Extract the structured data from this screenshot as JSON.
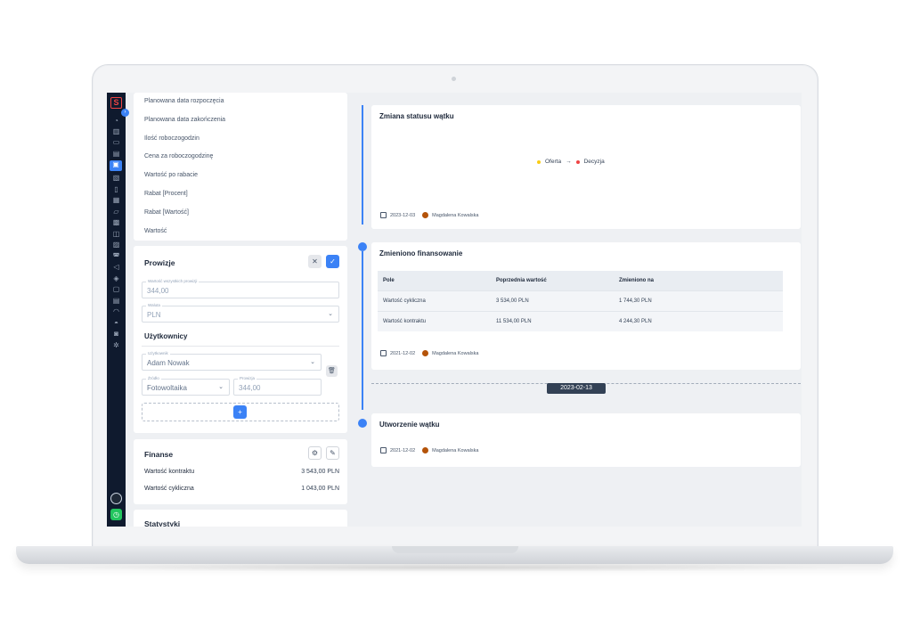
{
  "left": {
    "fields": [
      "Planowana data rozpoczęcia",
      "Planowana data zakończenia",
      "Ilość roboczogodzin",
      "Cena za roboczogodzinę",
      "Wartość po rabacie",
      "Rabat [Procent]",
      "Rabat [Wartość]",
      "Wartość"
    ],
    "prowizje": {
      "title": "Prowizje",
      "total_label": "Wartość wszystkich prowizji",
      "total_value": "344,00",
      "currency_label": "Waluta",
      "currency_value": "PLN",
      "users_title": "Użytkownicy",
      "user_label": "Użytkownik",
      "user_value": "Adam Nowak",
      "source_label": "Źródło",
      "source_value": "Fotowoltaika",
      "commission_label": "Prowizja",
      "commission_value": "344,00"
    },
    "finanse": {
      "title": "Finanse",
      "rows": [
        {
          "label": "Wartość kontraktu",
          "value": "3 543,00 PLN"
        },
        {
          "label": "Wartość cykliczna",
          "value": "1 043,00 PLN"
        }
      ]
    },
    "statystyki_title": "Statystyki"
  },
  "timeline": {
    "status_change": {
      "title": "Zmiana statusu wątku",
      "from": "Oferta",
      "arrow": "→",
      "to": "Decyzja",
      "from_color": "#facc15",
      "to_color": "#ef4444",
      "date": "2023-12-03",
      "author": "Magdalena Kowalska"
    },
    "financing": {
      "title": "Zmieniono finansowanie",
      "columns": [
        "Pole",
        "Poprzednia wartość",
        "Zmieniono na"
      ],
      "rows": [
        [
          "Wartość cykliczna",
          "3 534,00 PLN",
          "1 744,30 PLN"
        ],
        [
          "Wartość kontraktu",
          "11 534,00 PLN",
          "4 244,30 PLN"
        ]
      ],
      "date": "2021-12-02",
      "author": "Magdalena Kowalska"
    },
    "date_separator": "2023-02-13",
    "created": {
      "title": "Utworzenie wątku",
      "date": "2021-12-02",
      "author": "Magdalena Kowalska"
    }
  },
  "colors": {
    "accent": "#3b82f6",
    "sidebar": "#0f1a2e"
  },
  "icons": [
    "logo-icon",
    "home-icon",
    "chart-icon",
    "monitor-icon",
    "document-icon",
    "threads-icon",
    "notes-icon",
    "clipboard-icon",
    "calendar-icon",
    "folder-icon",
    "image-icon",
    "gift-icon",
    "group-icon",
    "car-icon",
    "megaphone-icon",
    "layers-icon",
    "box-icon",
    "database-icon",
    "bell-icon",
    "users-icon",
    "truck-icon",
    "settings-icon"
  ]
}
